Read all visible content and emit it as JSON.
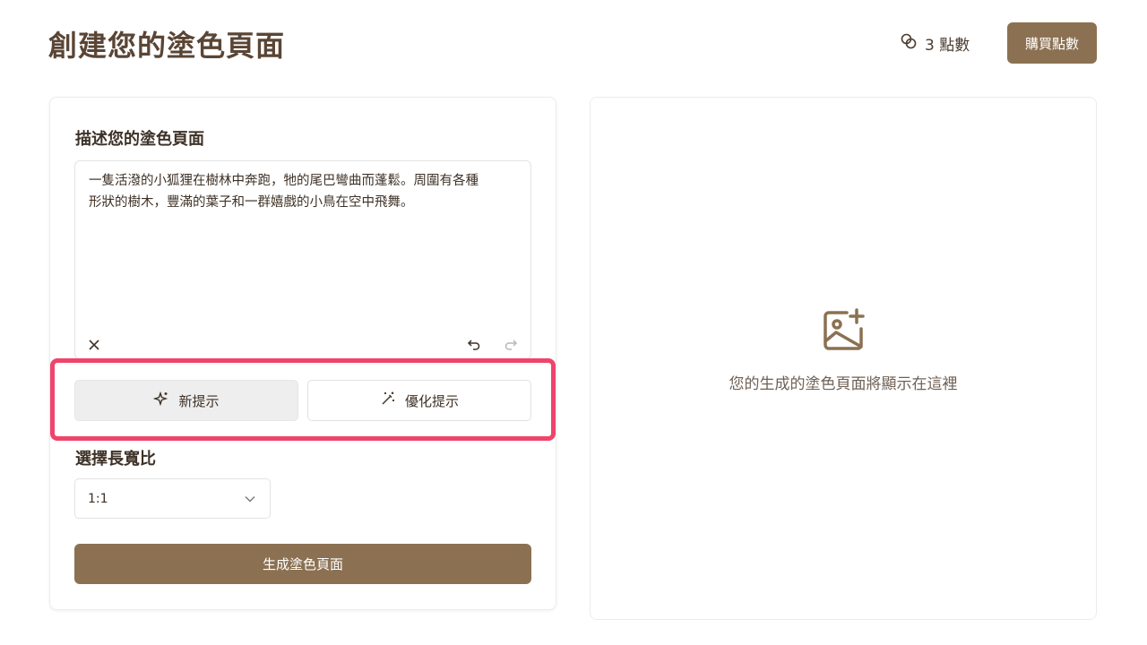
{
  "header": {
    "title": "創建您的塗色頁面",
    "credits_text": "3 點數",
    "buy_button": "購買點數"
  },
  "form": {
    "description_label": "描述您的塗色頁面",
    "description_value": "一隻活潑的小狐狸在樹林中奔跑，牠的尾巴彎曲而蓬鬆。周圍有各種\n形狀的樹木，豐滿的葉子和一群嬉戲的小鳥在空中飛舞。",
    "new_prompt_button": "新提示",
    "refine_prompt_button": "優化提示",
    "aspect_ratio_label": "選擇長寬比",
    "aspect_ratio_value": "1:1",
    "generate_button": "生成塗色頁面"
  },
  "preview": {
    "placeholder_text": "您的生成的塗色頁面將顯示在這裡"
  },
  "colors": {
    "accent": "#8b7152",
    "highlight": "#f0446a"
  },
  "icons": {
    "credits": "coins-icon",
    "clear": "close-icon",
    "undo": "undo-icon",
    "redo": "redo-icon",
    "new_prompt": "sparkles-icon",
    "refine_prompt": "magic-wand-icon",
    "dropdown": "chevron-down-icon",
    "placeholder": "image-plus-icon"
  }
}
